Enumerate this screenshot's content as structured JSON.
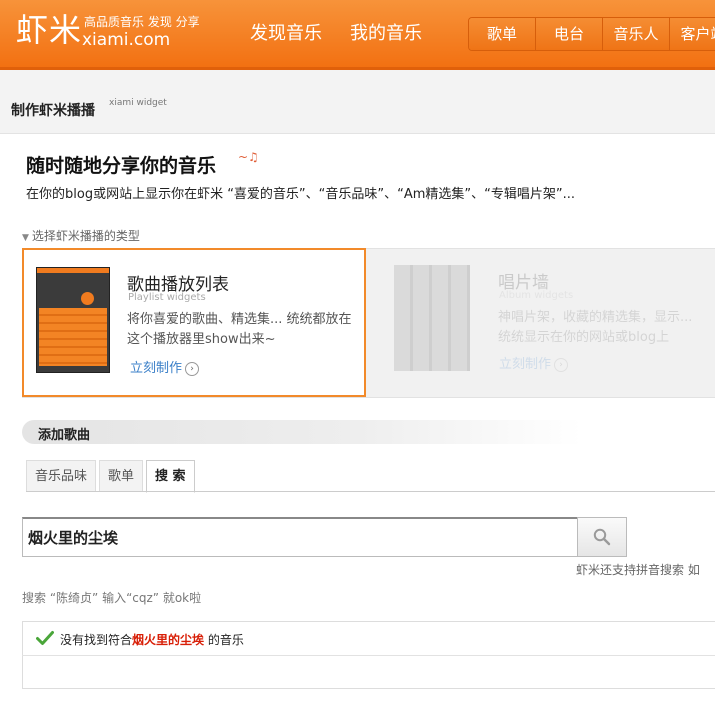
{
  "header": {
    "logo": "虾米",
    "tagline": "高品质音乐 发现 分享",
    "site_url": "xiami.com",
    "main_nav": [
      "发现音乐",
      "我的音乐"
    ],
    "sub_nav": [
      "歌单",
      "电台",
      "音乐人",
      "客户端"
    ],
    "brand_color": "#f26f10"
  },
  "page": {
    "title": "制作虾米播播",
    "subtitle": "xiami widget"
  },
  "intro": {
    "title": "随时随地分享你的音乐",
    "description": "在你的blog或网站上显示你在虾米 “喜爱的音乐”、“音乐品味”、“Am精选集”、“专辑唱片架”..."
  },
  "type_selector": {
    "label": "选择虾米播播的类型",
    "cards": [
      {
        "title": "歌曲播放列表",
        "subtitle": "Playlist widgets",
        "description": "将你喜爱的歌曲、精选集... 统统都放在这个播放器里show出来~",
        "link": "立刻制作"
      },
      {
        "title": "唱片墙",
        "subtitle": "Album widgets",
        "description": "神唱片架，收藏的精选集，显示... 统统显示在你的网站或blog上",
        "link": "立刻制作"
      }
    ]
  },
  "add_songs": {
    "title": "添加歌曲",
    "tabs": [
      "音乐品味",
      "歌单",
      "搜 索"
    ],
    "active_tab": "搜 索",
    "search_value": "烟火里的尘埃",
    "pinyin_tip": "虾米还支持拼音搜索 如",
    "hint": "搜索 “陈绮贞” 输入“cqz” 就ok啦",
    "result_prefix": "没有找到符合",
    "result_keyword": "烟火里的尘埃",
    "result_suffix": " 的音乐"
  }
}
